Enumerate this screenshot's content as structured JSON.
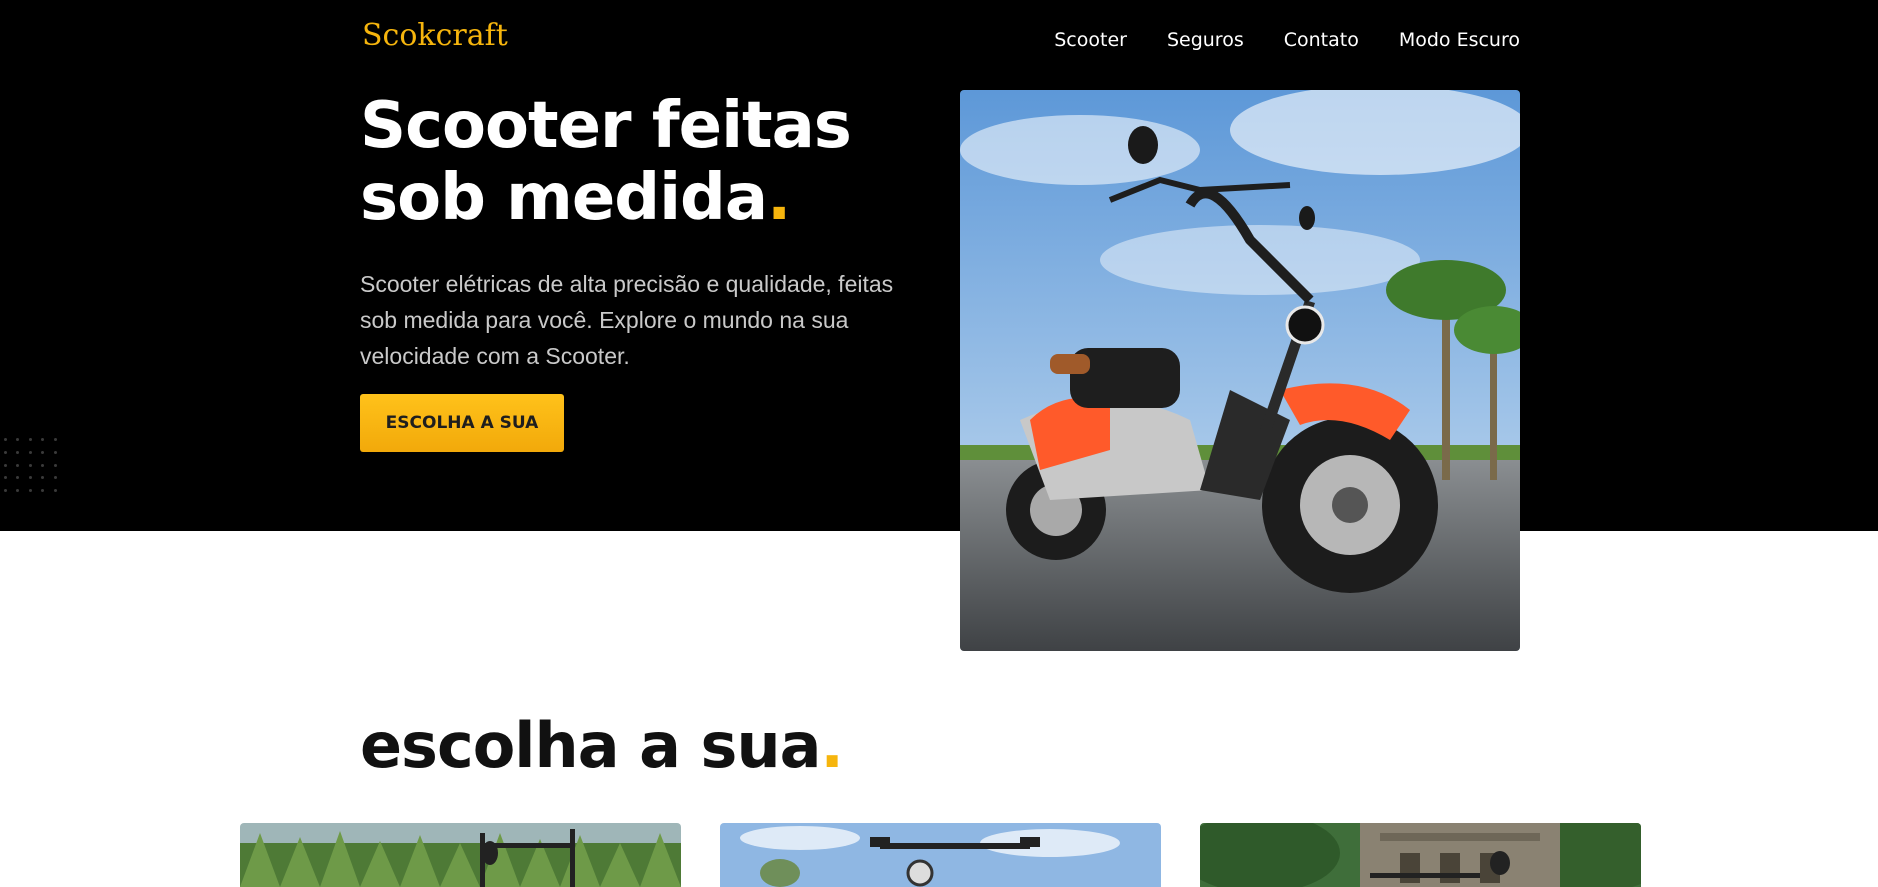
{
  "brand": {
    "name": "Scokcraft"
  },
  "nav": {
    "items": [
      "Scooter",
      "Seguros",
      "Contato",
      "Modo Escuro"
    ]
  },
  "hero": {
    "title_line1": "Scooter feitas",
    "title_line2": "sob medida",
    "dot": ".",
    "description": "Scooter elétricas de alta precisão e qualidade, feitas sob medida para você. Explore o mundo na sua velocidade com a Scooter.",
    "cta_label": "ESCOLHA A SUA"
  },
  "section": {
    "title": "escolha a sua",
    "dot": "."
  },
  "colors": {
    "accent": "#f6b50d",
    "background_dark": "#000000",
    "background_light": "#ffffff"
  }
}
